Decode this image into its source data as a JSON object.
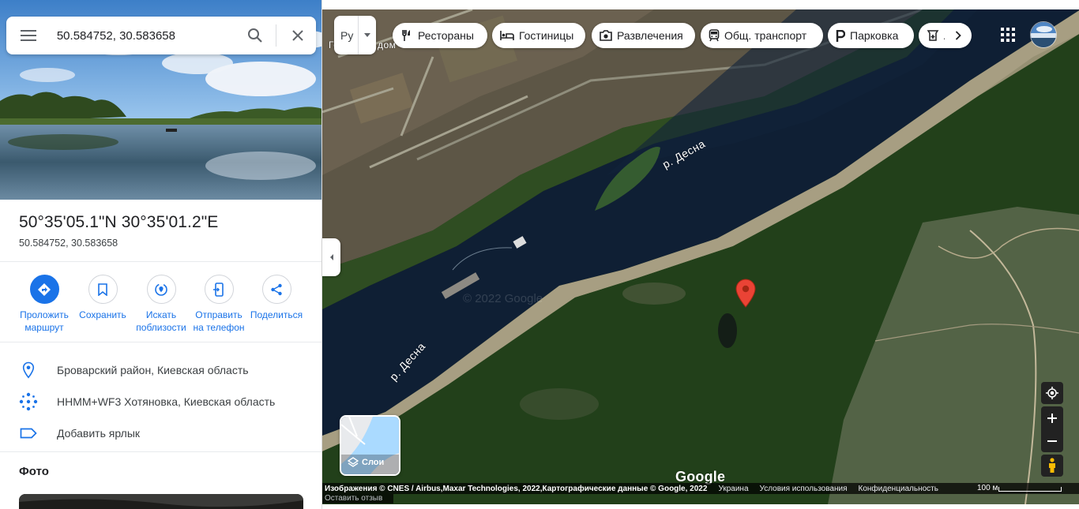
{
  "search": {
    "value": "50.584752, 30.583658",
    "placeholder": ""
  },
  "place": {
    "title": "50°35'05.1\"N 30°35'01.2\"E",
    "subtitle": "50.584752, 30.583658"
  },
  "actions": [
    {
      "label": "Проложить маршрут",
      "icon": "directions-icon"
    },
    {
      "label": "Сохранить",
      "icon": "bookmark-icon"
    },
    {
      "label": "Искать поблизости",
      "icon": "nearby-icon"
    },
    {
      "label": "Отправить на телефон",
      "icon": "send-to-phone-icon"
    },
    {
      "label": "Поделиться",
      "icon": "share-icon"
    }
  ],
  "info": [
    {
      "text": "Броварский район, Киевская область",
      "icon": "location-pin-icon"
    },
    {
      "text": "HHMM+WF3 Хотяновка, Киевская область",
      "icon": "plus-code-icon"
    },
    {
      "text": "Добавить ярлык",
      "icon": "label-icon"
    }
  ],
  "photos_title": "Фото",
  "map": {
    "language_label": "Ру",
    "chips": [
      {
        "label": "Рестораны",
        "icon": "restaurant-icon"
      },
      {
        "label": "Гостиницы",
        "icon": "hotel-icon"
      },
      {
        "label": "Развлечения",
        "icon": "camera-icon"
      },
      {
        "label": "Общ. транспорт",
        "icon": "transit-icon"
      },
      {
        "label": "Парковка",
        "icon": "parking-icon"
      },
      {
        "label": "А",
        "icon": "pharmacy-icon"
      }
    ],
    "river_label_1": "р. Десна",
    "river_label_2": "р. Десна",
    "partial_label_top": "Го",
    "partial_label_top_2": "дом",
    "watermark": "© 2022 Google",
    "layers_label": "Слои",
    "google_logo": "Google",
    "attribution": {
      "imagery": "Изображения © CNES / Airbus,Maxar Technologies, 2022,Картографические данные © Google, 2022",
      "country": "Украина",
      "terms": "Условия использования",
      "privacy": "Конфиденциальность",
      "feedback": "Оставить отзыв",
      "scale": "100 м"
    }
  },
  "colors": {
    "accent": "#1a73e8",
    "pin": "#ea4335",
    "water": "#0f1f34"
  }
}
